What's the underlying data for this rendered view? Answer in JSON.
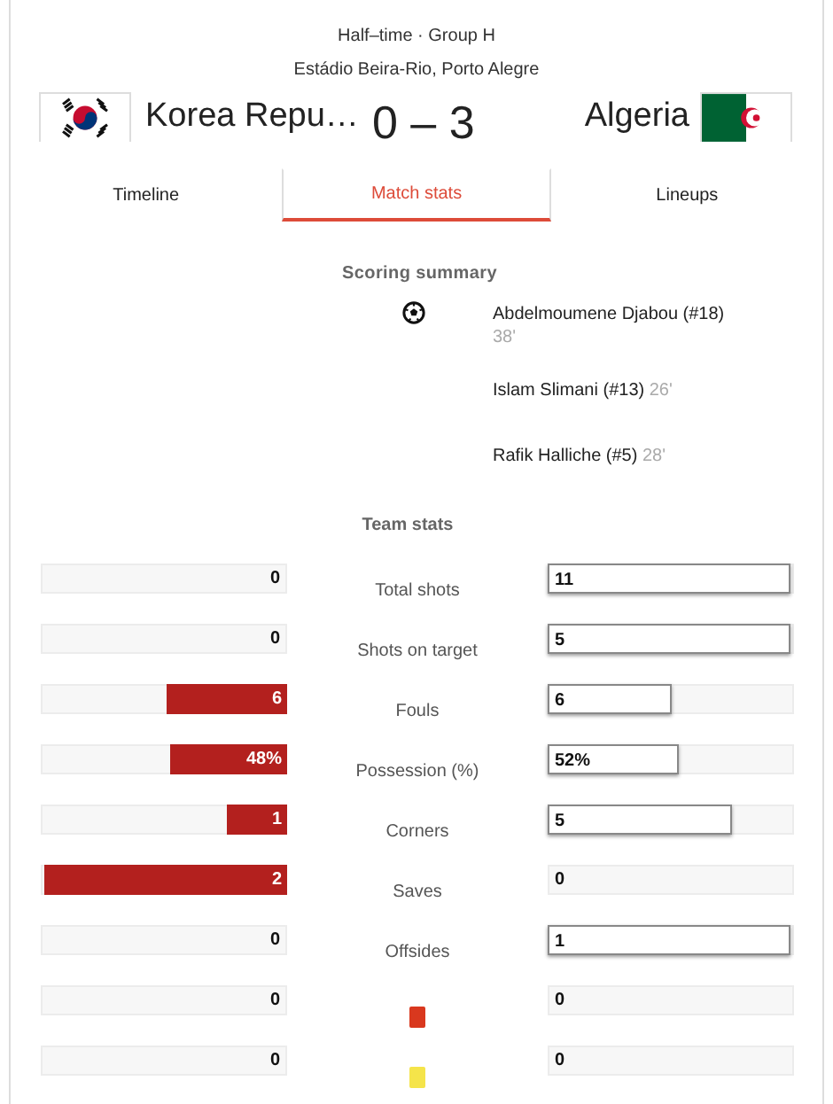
{
  "header": {
    "status": "Half–time · Group H",
    "venue": "Estádio Beira-Rio, Porto Alegre",
    "home_team": "Korea Repu…",
    "score": "0 – 3",
    "away_team": "Algeria"
  },
  "tabs": [
    {
      "label": "Timeline",
      "selected": false
    },
    {
      "label": "Match stats",
      "selected": true
    },
    {
      "label": "Lineups",
      "selected": false
    }
  ],
  "scoring_summary": {
    "title": "Scoring summary",
    "goals": [
      {
        "scorer": "Abdelmoumene Djabou (#18)",
        "minute": "38'",
        "ball_icon": true
      },
      {
        "scorer": "Islam Slimani (#13)",
        "minute": "26'",
        "ball_icon": false
      },
      {
        "scorer": "Rafik Halliche (#5)",
        "minute": "28'",
        "ball_icon": false
      }
    ]
  },
  "team_stats": {
    "title": "Team stats",
    "rows": [
      {
        "kind": "label",
        "label": "Total shots",
        "home": {
          "value": "0"
        },
        "away": {
          "value": "11",
          "level": 1
        }
      },
      {
        "kind": "label",
        "label": "Shots on target",
        "home": {
          "value": "0"
        },
        "away": {
          "value": "5",
          "level": 1
        }
      },
      {
        "kind": "label",
        "label": "Fouls",
        "home": {
          "value": "6",
          "level": 0.5
        },
        "away": {
          "value": "6",
          "level": 0.51
        }
      },
      {
        "kind": "label",
        "label": "Possession (%)",
        "home": {
          "value": "48%",
          "level": 0.48
        },
        "away": {
          "value": "52%",
          "level": 0.54
        }
      },
      {
        "kind": "label",
        "label": "Corners",
        "home": {
          "value": "1",
          "level": 0.25
        },
        "away": {
          "value": "5",
          "level": 0.76
        }
      },
      {
        "kind": "label",
        "label": "Saves",
        "home": {
          "value": "2",
          "level": 1
        },
        "away": {
          "value": "0"
        }
      },
      {
        "kind": "label",
        "label": "Offsides",
        "home": {
          "value": "0"
        },
        "away": {
          "value": "1",
          "level": 1
        }
      },
      {
        "kind": "card",
        "color": "#d9381e",
        "home": {
          "value": "0"
        },
        "away": {
          "value": "0"
        }
      },
      {
        "kind": "card",
        "color": "#f5e44a",
        "home": {
          "value": "0"
        },
        "away": {
          "value": "0"
        }
      }
    ]
  }
}
